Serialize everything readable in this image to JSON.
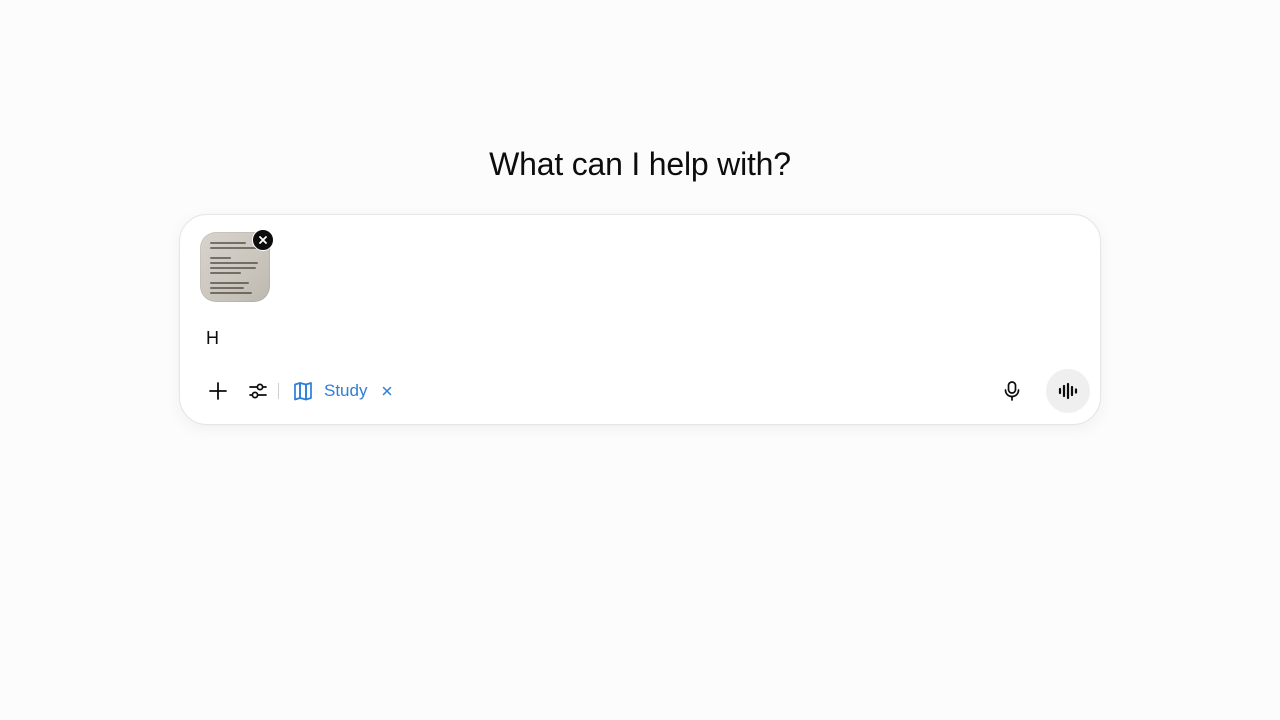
{
  "main": {
    "heading": "What can I help with?"
  },
  "composer": {
    "input_value": "H",
    "attachment": {
      "icon": "document-thumbnail",
      "remove_icon": "close-icon"
    },
    "toolbar": {
      "add_icon": "plus-icon",
      "tools_icon": "sliders-icon",
      "study_mode": {
        "label": "Study",
        "icon": "book-open-icon",
        "remove_icon": "close-icon",
        "color": "#2b7fd8"
      },
      "mic_icon": "microphone-icon",
      "voice_icon": "voice-waveform-icon"
    }
  },
  "colors": {
    "background": "#fcfcfc",
    "accent": "#2b7fd8",
    "text": "#0d0d0d"
  }
}
